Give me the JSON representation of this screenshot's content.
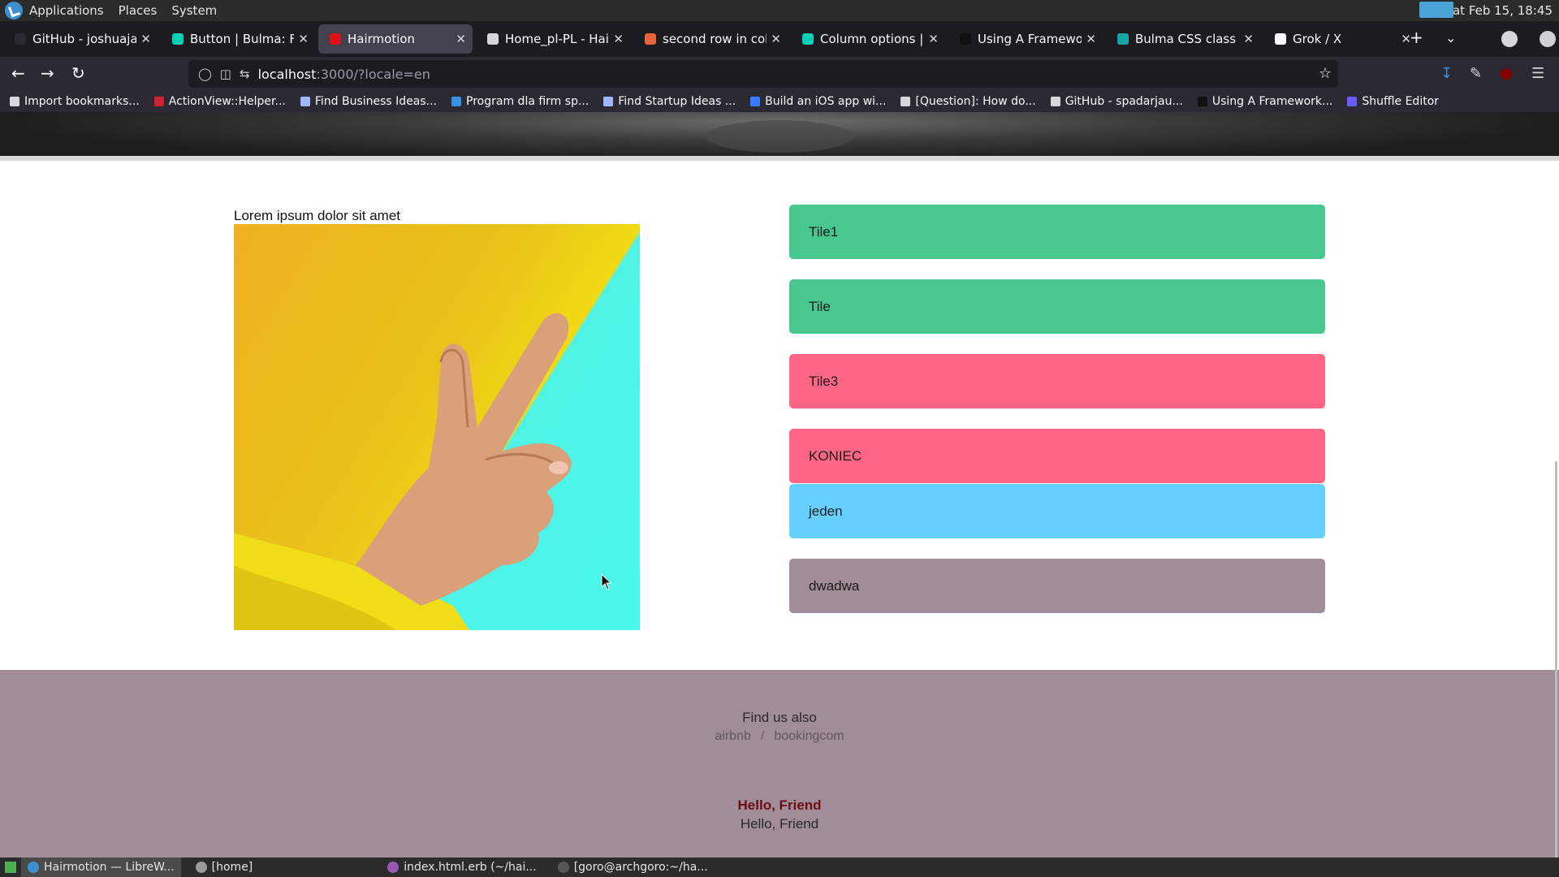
{
  "os_panel": {
    "menus": [
      "Applications",
      "Places",
      "System"
    ],
    "clock": "Sat Feb 15, 18:45"
  },
  "tabs": [
    {
      "title": "GitHub - joshuajans",
      "favicon_color": "#2b2a33",
      "active": false
    },
    {
      "title": "Button | Bulma: Fre",
      "favicon_color": "#00d1b2",
      "active": false
    },
    {
      "title": "Hairmotion",
      "favicon_color": "#e0101a",
      "active": true
    },
    {
      "title": "Home_pl-PL - Hair i",
      "favicon_color": "#d7d7db",
      "active": false
    },
    {
      "title": "second row in colum",
      "favicon_color": "#e8663d",
      "active": false
    },
    {
      "title": "Column options | Bu",
      "favicon_color": "#00d1b2",
      "active": false
    },
    {
      "title": "Using A Framework",
      "favicon_color": "#111111",
      "active": false
    },
    {
      "title": "Bulma CSS class .til",
      "favicon_color": "#16a6a6",
      "active": false
    },
    {
      "title": "Grok / X",
      "favicon_color": "#ffffff",
      "active": false
    }
  ],
  "navbar": {
    "url_host": "localhost",
    "url_path": ":3000/?locale=en"
  },
  "bookmarks": [
    {
      "label": "Import bookmarks...",
      "color": "#d7d7db"
    },
    {
      "label": "ActionView::Helper...",
      "color": "#cc2233"
    },
    {
      "label": "Find Business Ideas...",
      "color": "#9fb7ff"
    },
    {
      "label": "Program dla firm sp...",
      "color": "#3a8ee6"
    },
    {
      "label": "Find Startup Ideas ...",
      "color": "#9fb7ff"
    },
    {
      "label": "Build an iOS app wi...",
      "color": "#3a7bff"
    },
    {
      "label": "[Question]: How do...",
      "color": "#d7d7db"
    },
    {
      "label": "GitHub - spadarjau...",
      "color": "#d7d7db"
    },
    {
      "label": "Using A Framework...",
      "color": "#111111"
    },
    {
      "label": "Shuffle Editor",
      "color": "#6a5cff"
    }
  ],
  "content": {
    "lorem": "Lorem ipsum dolor sit amet",
    "tiles": [
      {
        "label": "Tile1",
        "color": "green"
      },
      {
        "label": "Tile",
        "color": "green"
      },
      {
        "label": "Tile3",
        "color": "red"
      },
      {
        "label": "KONIEC",
        "color": "red"
      },
      {
        "label": "jeden",
        "color": "blue"
      },
      {
        "label": "dwadwa",
        "color": "mauve"
      }
    ]
  },
  "footer": {
    "find_us": "Find us also",
    "links": [
      "airbnb",
      "bookingcom"
    ],
    "separator": "/",
    "hello_bold": "Hello, Friend",
    "hello_regular": "Hello, Friend"
  },
  "taskbar": {
    "items": [
      {
        "label": "Hairmotion — LibreW...",
        "color": "#3d8fd1",
        "active": true
      },
      {
        "label": "[home]",
        "color": "#9a9a9a",
        "active": false
      },
      {
        "label": "index.html.erb (~/hai...",
        "color": "#9b59b6",
        "active": false
      },
      {
        "label": "[goro@archgoro:~/ha...",
        "color": "#555555",
        "active": false
      }
    ]
  }
}
